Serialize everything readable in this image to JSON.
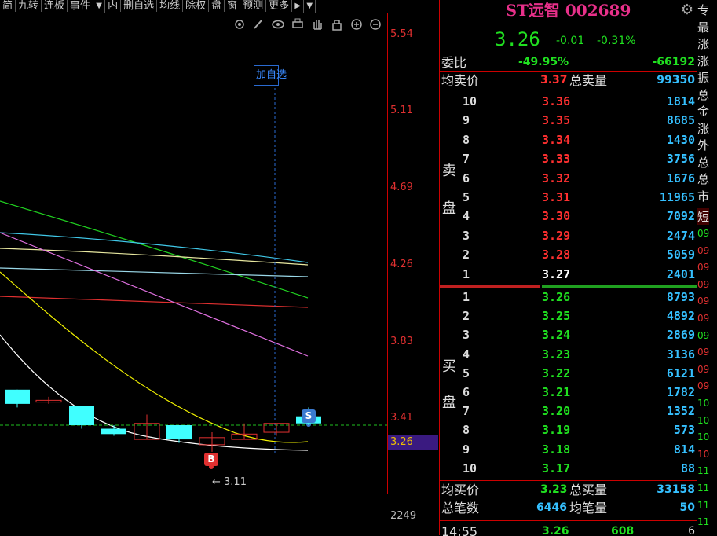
{
  "toolbar": {
    "items": [
      "简",
      "九转",
      "连板",
      "事件",
      "▼",
      "内",
      "删自选",
      "均线",
      "除权",
      "盘",
      "窗",
      "预测",
      "更多",
      "▶",
      "▼"
    ]
  },
  "chart": {
    "icons": [
      "settings-icon",
      "brush-icon",
      "eye-icon",
      "print-icon",
      "hand-icon",
      "lock-icon",
      "zoom-in-icon",
      "zoom-out-icon"
    ],
    "add_favorite_label": "加自选",
    "buy_mark": "B",
    "sell_mark": "S",
    "low_price_label": "← 3.11",
    "price_axis_ticks": [
      "5.54",
      "5.11",
      "4.69",
      "4.26",
      "3.83",
      "3.41"
    ],
    "current_price": "3.26",
    "volume_axis_label": "2249",
    "candles": [
      {
        "o": 3.46,
        "c": 3.38,
        "h": 3.46,
        "l": 3.36,
        "up": false
      },
      {
        "o": 3.39,
        "c": 3.4,
        "h": 3.42,
        "l": 3.38,
        "up": true
      },
      {
        "o": 3.37,
        "c": 3.26,
        "h": 3.37,
        "l": 3.24,
        "up": false
      },
      {
        "o": 3.24,
        "c": 3.21,
        "h": 3.26,
        "l": 3.2,
        "up": false
      },
      {
        "o": 3.18,
        "c": 3.27,
        "h": 3.32,
        "l": 3.18,
        "up": true
      },
      {
        "o": 3.26,
        "c": 3.18,
        "h": 3.26,
        "l": 3.16,
        "up": false
      },
      {
        "o": 3.15,
        "c": 3.19,
        "h": 3.22,
        "l": 3.11,
        "up": true
      },
      {
        "o": 3.18,
        "c": 3.21,
        "h": 3.27,
        "l": 3.18,
        "up": true
      },
      {
        "o": 3.22,
        "c": 3.27,
        "h": 3.27,
        "l": 3.2,
        "up": true
      },
      {
        "o": 3.27,
        "c": 3.31,
        "h": 3.36,
        "l": 3.26,
        "up": false
      }
    ],
    "colors": {
      "up": "#e03030",
      "down": "#40ffff",
      "ma5": "#ffffff",
      "ma10": "#f0f000",
      "ma20": "#e070e0",
      "ma30": "#20d020",
      "ma60": "#40c8e8",
      "ma120": "#e8e8a0",
      "ma250": "#e03030",
      "ma_other": "#9ad8e8"
    }
  },
  "panel": {
    "title": "ST远智 002689",
    "last_price": "3.26",
    "change": "-0.01",
    "change_pct": "-0.31%",
    "weibi_label": "委比",
    "weibi_pct": "-49.95%",
    "weibi_val": "-66192",
    "avg_sell_label": "均卖价",
    "avg_sell_price": "3.37",
    "total_sell_label": "总卖量",
    "total_sell_vol": "99350",
    "sell_side_label": [
      "卖",
      "盘"
    ],
    "sell_orders": [
      {
        "lv": "10",
        "price": "3.36",
        "vol": "1814"
      },
      {
        "lv": "9",
        "price": "3.35",
        "vol": "8685"
      },
      {
        "lv": "8",
        "price": "3.34",
        "vol": "1430"
      },
      {
        "lv": "7",
        "price": "3.33",
        "vol": "3756"
      },
      {
        "lv": "6",
        "price": "3.32",
        "vol": "1676"
      },
      {
        "lv": "5",
        "price": "3.31",
        "vol": "11965"
      },
      {
        "lv": "4",
        "price": "3.30",
        "vol": "7092"
      },
      {
        "lv": "3",
        "price": "3.29",
        "vol": "2474"
      },
      {
        "lv": "2",
        "price": "3.28",
        "vol": "5059"
      },
      {
        "lv": "1",
        "price": "3.27",
        "vol": "2401"
      }
    ],
    "buy_side_label": [
      "买",
      "盘"
    ],
    "buy_orders": [
      {
        "lv": "1",
        "price": "3.26",
        "vol": "8793"
      },
      {
        "lv": "2",
        "price": "3.25",
        "vol": "4892"
      },
      {
        "lv": "3",
        "price": "3.24",
        "vol": "2869"
      },
      {
        "lv": "4",
        "price": "3.23",
        "vol": "3136"
      },
      {
        "lv": "5",
        "price": "3.22",
        "vol": "6121"
      },
      {
        "lv": "6",
        "price": "3.21",
        "vol": "1782"
      },
      {
        "lv": "7",
        "price": "3.20",
        "vol": "1352"
      },
      {
        "lv": "8",
        "price": "3.19",
        "vol": "573"
      },
      {
        "lv": "9",
        "price": "3.18",
        "vol": "814"
      },
      {
        "lv": "10",
        "price": "3.17",
        "vol": "88"
      }
    ],
    "avg_buy_label": "均买价",
    "avg_buy_price": "3.23",
    "total_buy_label": "总买量",
    "total_buy_vol": "33158",
    "total_trades_label": "总笔数",
    "total_trades": "6446",
    "avg_trade_label": "均笔量",
    "avg_trade_vol": "50",
    "last_tick": {
      "time": "14:55",
      "price": "3.26",
      "vol": "608",
      "count": "6"
    }
  },
  "right_strip": {
    "labels": [
      "专",
      "最",
      "涨",
      "涨",
      "振",
      "总",
      "金",
      "涨",
      "外",
      "总",
      "总",
      "市"
    ],
    "short_label": "短",
    "times": [
      "09",
      "09",
      "09",
      "09",
      "09",
      "09",
      "09",
      "09",
      "09",
      "09",
      "10",
      "10",
      "10",
      "10",
      "11",
      "11",
      "11",
      "11"
    ]
  }
}
